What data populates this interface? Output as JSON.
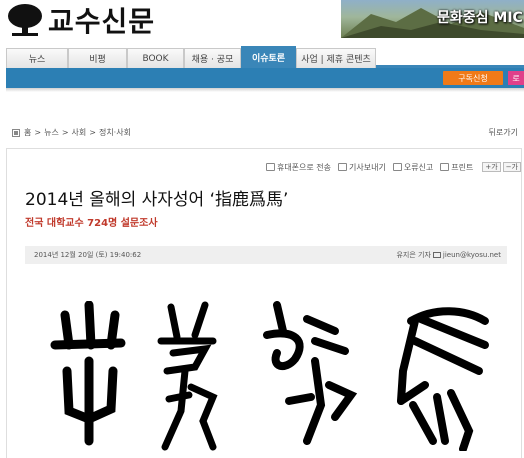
{
  "header": {
    "logo_text": "교수신문",
    "logo_icon": "tree-icon",
    "banner_text": "문화중심 MIC"
  },
  "nav": {
    "tabs": [
      {
        "label": "뉴스",
        "active": false
      },
      {
        "label": "비평",
        "active": false
      },
      {
        "label": "BOOK",
        "active": false
      },
      {
        "label": "채용 · 공모",
        "active": false
      },
      {
        "label": "이슈토론",
        "active": true
      },
      {
        "label": "사업 | 제휴 콘텐츠",
        "active": false
      }
    ],
    "subscribe_label": "구독신청",
    "extra_label": "로"
  },
  "breadcrumb": {
    "items": [
      "홈",
      ">",
      "뉴스",
      ">",
      "사회",
      ">",
      "정치·사회"
    ],
    "back_label": "뒤로가기"
  },
  "tools": {
    "send_phone": "휴대폰으로 전송",
    "view_article": "기사보내기",
    "report_error": "오류신고",
    "print": "프린트",
    "font_up": "+가",
    "font_down": "−가"
  },
  "article": {
    "title": "2014년 올해의 사자성어 ‘指鹿爲馬’",
    "subtitle": "전국 대학교수 724명 설문조사",
    "date": "2014년 12월 20일 (토) 19:40:62",
    "author": "유지은 기자",
    "email": "jieun@kyosu.net"
  },
  "colors": {
    "nav_blue": "#3a86b8",
    "subscribe_orange": "#f07a18",
    "subtitle_red": "#c0392b"
  }
}
